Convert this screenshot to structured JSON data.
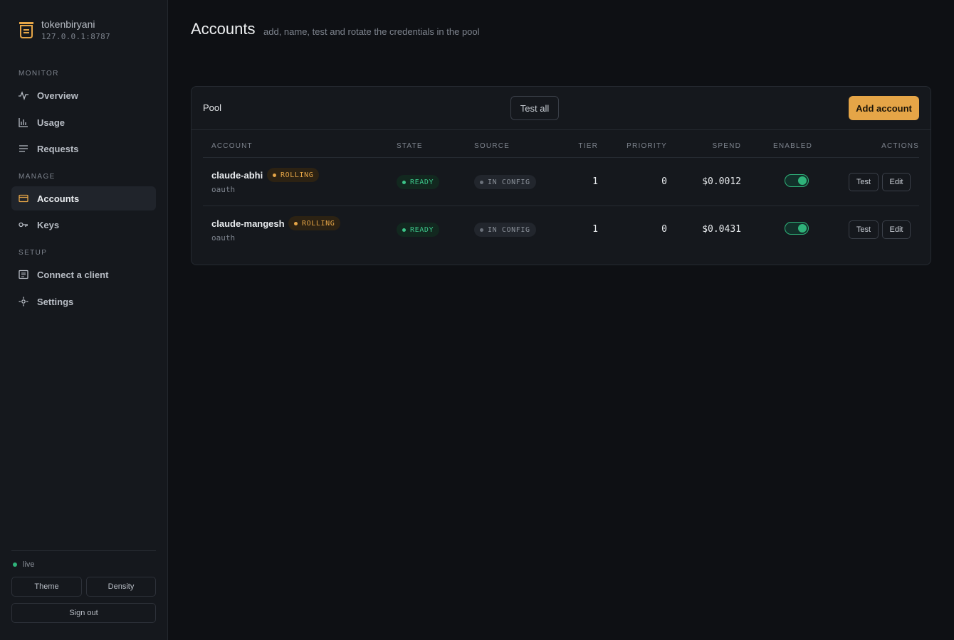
{
  "brand": {
    "name": "tokenbiryani",
    "address": "127.0.0.1:8787",
    "logo_icon": "box-logo-icon",
    "accent": "#e5a547"
  },
  "nav": {
    "monitor_label": "MONITOR",
    "manage_label": "MANAGE",
    "setup_label": "SETUP",
    "items": [
      {
        "label": "Overview",
        "icon": "pulse-icon"
      },
      {
        "label": "Usage",
        "icon": "bar-chart-icon"
      },
      {
        "label": "Requests",
        "icon": "list-icon"
      },
      {
        "label": "Accounts",
        "icon": "card-icon",
        "active": true
      },
      {
        "label": "Keys",
        "icon": "key-icon"
      },
      {
        "label": "Connect a client",
        "icon": "terminal-icon"
      },
      {
        "label": "Settings",
        "icon": "gear-icon"
      }
    ]
  },
  "footer": {
    "status": "live",
    "theme_label": "Theme",
    "density_label": "Density",
    "signout_label": "Sign out"
  },
  "header": {
    "title": "Accounts",
    "subtitle": "add, name, test and rotate the credentials in the pool"
  },
  "pool": {
    "title": "Pool",
    "test_all_label": "Test all",
    "add_label": "Add account",
    "columns": [
      "ACCOUNT",
      "STATE",
      "SOURCE",
      "TIER",
      "PRIORITY",
      "SPEND",
      "ENABLED",
      "ACTIONS"
    ],
    "rows": [
      {
        "name": "claude-abhi",
        "badge": "ROLLING",
        "type": "oauth",
        "state": "READY",
        "source": "IN CONFIG",
        "tier": "1",
        "priority": "0",
        "spend": "$0.0012",
        "enabled": true,
        "test_label": "Test",
        "edit_label": "Edit"
      },
      {
        "name": "claude-mangesh",
        "badge": "ROLLING",
        "type": "oauth",
        "state": "READY",
        "source": "IN CONFIG",
        "tier": "1",
        "priority": "0",
        "spend": "$0.0431",
        "enabled": true,
        "test_label": "Test",
        "edit_label": "Edit"
      }
    ]
  }
}
